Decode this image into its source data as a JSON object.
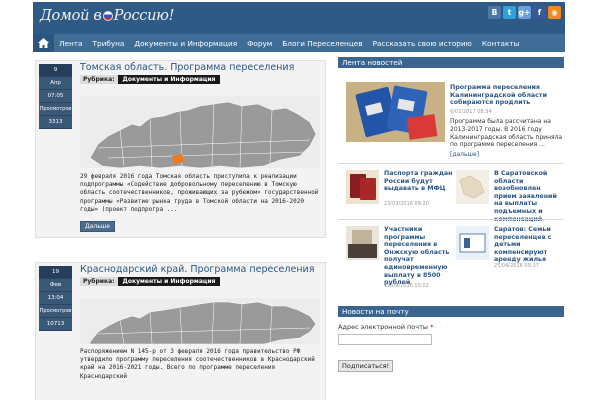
{
  "header": {
    "logo_part1": "Домой в",
    "logo_part2": "Россию!",
    "social": [
      {
        "icon": "vk-icon",
        "glyph": "B",
        "color": "#4a76a8"
      },
      {
        "icon": "twitter-icon",
        "glyph": "t",
        "color": "#2ea2dc"
      },
      {
        "icon": "google-plus-icon",
        "glyph": "g+",
        "color": "#6a9fd9"
      },
      {
        "icon": "facebook-icon",
        "glyph": "f",
        "color": "#3b5998"
      },
      {
        "icon": "rss-icon",
        "glyph": "◉",
        "color": "#f08a1a"
      }
    ]
  },
  "nav": {
    "home_icon": "home-icon",
    "items": [
      "Лента",
      "Трибуна",
      "Документы и Информация",
      "Форум",
      "Блоги Переселенцев",
      "Рассказать свою историю",
      "Контакты"
    ]
  },
  "posts": [
    {
      "day": "9",
      "month": "Апр",
      "time": "07:05",
      "views_label": "Просмотров",
      "views": "3313",
      "title": "Томская область. Программа переселения",
      "rubric_label": "Рубрика:",
      "rubric": "Документы и Информация",
      "excerpt": "29 февраля 2016 года Томская область приступила к реализации подпрограммы «Содействие добровольному переселению в Томскую область соотечественников, проживающих за рубежом» государственной программы «Развитие рынка труда в Томской области на 2016-2020 годы» (проект подпрогра ...",
      "more": "Дальше"
    },
    {
      "day": "19",
      "month": "Фев",
      "time": "13:04",
      "views_label": "Просмотров",
      "views": "10713",
      "title": "Краснодарский край. Программа переселения",
      "rubric_label": "Рубрика:",
      "rubric": "Документы и Информация",
      "excerpt": "Распоряжением N 145-р от 3 февраля 2016 года правительство РФ утвердило программу переселения соотечественников в Краснодарский край на 2016-2021 годы. Всего по программе переселения Краснодарский"
    }
  ],
  "sidebar": {
    "news_title": "Лента новостей",
    "feature": {
      "title": "Программа переселения Калининградской области собираются продлить",
      "date": "6/03/2017 08:34",
      "text": "Программа была рассчитана на 2013-2017 годы. В 2016 году Калининградская область приняла по программе переселения ...",
      "more": "[дальше]"
    },
    "items": [
      {
        "title": "Паспорта граждан России будут выдавать в МФЦ",
        "date": "23/03/2016 09:20"
      },
      {
        "title": "В Саратовской области возобновлен прием заявлений на выплаты подъемных и компенсаций",
        "date": ""
      },
      {
        "title": "Участники программы переселения в Онжскую область получат единовременную выплату в 8500 рублей",
        "date": "19/09/2016 10:02"
      },
      {
        "title": "Саратов: Семьи переселенцев с детьми компенсируют аренду жилья",
        "date": "25/04/2016 09:37"
      }
    ],
    "mail_title": "Новости на почту",
    "email_label": "Адрес электронной почты",
    "required_mark": "*",
    "email_value": "",
    "subscribe": "Подписаться!"
  }
}
